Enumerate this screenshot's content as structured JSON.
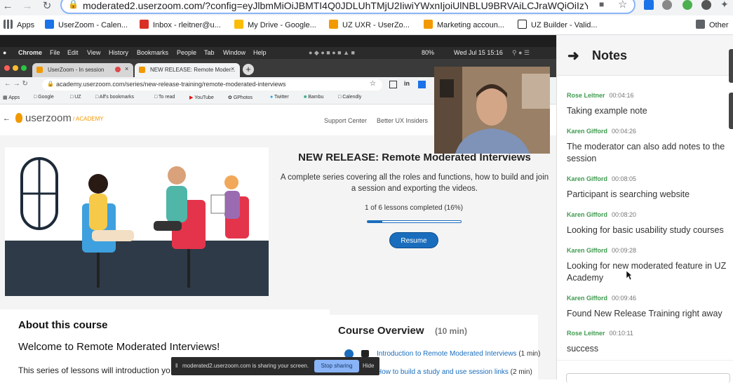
{
  "outer_browser": {
    "url": "moderated2.userzoom.com/?config=eyJlbmMiOiJBMTI4Q0JDLUhTMjU2IiwiYWxnIjoiUlNBLU9BRVAiLCJraWQiOiIzYjA3MDAy...",
    "bookmarks": [
      {
        "label": "Apps",
        "icon": "apps-grid-icon",
        "color": "#5f6368"
      },
      {
        "label": "UserZoom - Calen...",
        "icon": "calendar-icon",
        "color": "#1a73e8"
      },
      {
        "label": "Inbox - rleitner@u...",
        "icon": "gmail-icon",
        "color": "#d93025"
      },
      {
        "label": "My Drive - Google...",
        "icon": "drive-icon",
        "color": "#fbbc04"
      },
      {
        "label": "UZ UXR - UserZo...",
        "icon": "userzoom-icon",
        "color": "#f29900"
      },
      {
        "label": "Marketing accoun...",
        "icon": "userzoom-icon",
        "color": "#f29900"
      },
      {
        "label": "UZ Builder - Valid...",
        "icon": "checkbox-icon",
        "color": "#202124"
      },
      {
        "label": "Other",
        "icon": "folder-icon",
        "color": "#5f6368"
      }
    ]
  },
  "shared_screen": {
    "mac_menu": [
      "Chrome",
      "File",
      "Edit",
      "View",
      "History",
      "Bookmarks",
      "People",
      "Tab",
      "Window",
      "Help"
    ],
    "mac_status": {
      "battery": "80%",
      "datetime": "Wed Jul 15  15:16"
    },
    "tabs": [
      {
        "label": "UserZoom - In session"
      },
      {
        "label": "NEW RELEASE: Remote Moder..."
      }
    ],
    "inner_url": "academy.userzoom.com/series/new-release-training/remote-moderated-interviews",
    "inner_bookmarks": [
      "Apps",
      "Google",
      "UZ",
      "Alf's bookmarks",
      "To read",
      "YouTube",
      "GPhotos",
      "Twitter",
      "Bambu",
      "Calendly"
    ],
    "site": {
      "logo_text": "userzoom",
      "logo_suffix": "/ ACADEMY",
      "nav": [
        "Support Center",
        "Better UX Insiders"
      ],
      "course_title": "NEW RELEASE: Remote Moderated Interviews",
      "course_desc": "A complete series covering all the roles and functions, how to build and join a session and exporting the videos.",
      "progress_text": "1 of 6 lessons completed (16%)",
      "progress_fraction": 0.16,
      "resume_label": "Resume",
      "about_heading": "About this course",
      "welcome_heading": "Welcome to Remote Moderated Interviews!",
      "about_text": "This series of lessons will introduction yo",
      "overview_heading": "Course Overview",
      "overview_duration": "(10 min)",
      "lessons": [
        {
          "title": "Introduction to Remote Moderated Interviews",
          "duration": "(1 min)"
        },
        {
          "title": "How to build a study and use session links",
          "duration": "(2 min)"
        }
      ]
    },
    "share_banner": {
      "text": "moderated2.userzoom.com is sharing your screen.",
      "stop_label": "Stop sharing",
      "hide_label": "Hide"
    }
  },
  "notes_panel": {
    "title": "Notes",
    "notes": [
      {
        "author": "Rose Leitner",
        "time": "00:04:16",
        "text": "Taking example note"
      },
      {
        "author": "Karen Gifford",
        "time": "00:04:26",
        "text": "The moderator can also add notes to the session"
      },
      {
        "author": "Karen Gifford",
        "time": "00:08:05",
        "text": "Participant is searching website"
      },
      {
        "author": "Karen Gifford",
        "time": "00:08:20",
        "text": "Looking for basic usability study courses"
      },
      {
        "author": "Karen Gifford",
        "time": "00:09:28",
        "text": "Looking for new moderated feature in UZ Academy"
      },
      {
        "author": "Karen Gifford",
        "time": "00:09:46",
        "text": "Found New Release Training right away"
      },
      {
        "author": "Rose Leitner",
        "time": "00:10:11",
        "text": "success"
      }
    ]
  }
}
